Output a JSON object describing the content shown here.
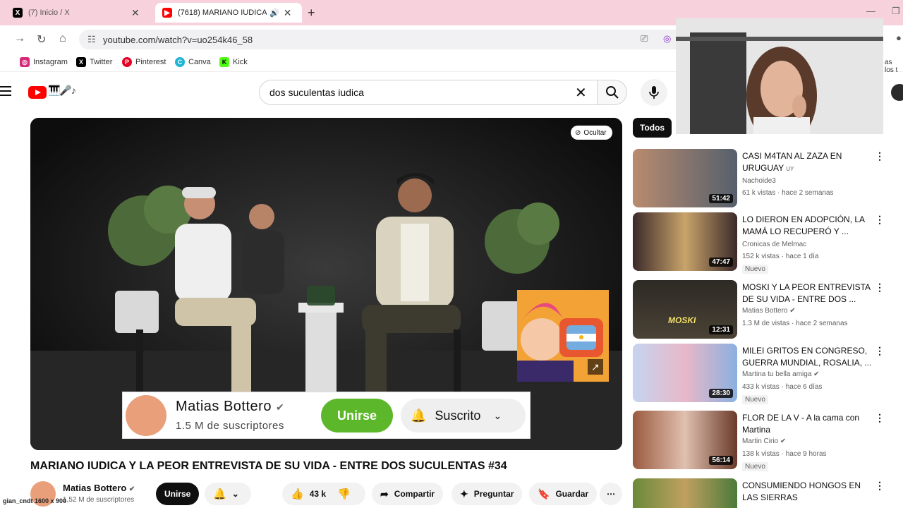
{
  "browser": {
    "tabs": [
      {
        "title": "(7) Inicio / X",
        "icon": "x-logo-icon"
      },
      {
        "title": "(7618) MARIANO IUDICA Y",
        "icon": "youtube-icon"
      }
    ],
    "url": "youtube.com/watch?v=uo254k46_58",
    "bookmarks": [
      "Instagram",
      "Twitter",
      "Pinterest",
      "Canva",
      "Kick"
    ],
    "right_overflow": "as los t"
  },
  "youtube": {
    "search_query": "dos suculentas iudica",
    "player": {
      "hide_label": "Ocultar",
      "card": {
        "channel": "Matias Bottero",
        "subscribers": "1.5 M de suscriptores",
        "join": "Unirse",
        "subscribed": "Suscrito"
      }
    },
    "video_title": "MARIANO IUDICA Y LA PEOR ENTREVISTA DE SU VIDA - ENTRE DOS SUCULENTAS #34",
    "channel": {
      "name": "Matias Bottero",
      "subscribers": "1,52 M de suscriptores"
    },
    "actions": {
      "join": "Unirse",
      "likes": "43 k",
      "share": "Compartir",
      "ask": "Preguntar",
      "save": "Guardar"
    },
    "watermark": "gian_cndt  1600 x 900",
    "chip": "Todos",
    "recommendations": [
      {
        "title": "CASI M4TAN AL ZAZA EN URUGUAY",
        "flag": "UY",
        "channel": "Nachoide3",
        "meta": "61 k vistas · hace 2 semanas",
        "duration": "51:42",
        "badge": ""
      },
      {
        "title": "LO DIERON EN ADOPCIÓN, LA MAMÁ LO RECUPERÓ Y ...",
        "flag": "",
        "channel": "Cronicas de Melmac",
        "meta": "152 k vistas · hace 1 día",
        "duration": "47:47",
        "badge": "Nuevo"
      },
      {
        "title": "MOSKI Y LA PEOR ENTREVISTA DE SU VIDA - ENTRE DOS ...",
        "flag": "",
        "channel": "Matias Bottero",
        "meta": "1.3 M de vistas · hace 2 semanas",
        "duration": "12:31",
        "badge": ""
      },
      {
        "title": "MILEI GRITOS EN CONGRESO, GUERRA MUNDIAL, ROSALIA, ...",
        "flag": "",
        "channel": "Martina tu bella amiga",
        "meta": "433 k vistas · hace 6 días",
        "duration": "28:30",
        "badge": "Nuevo"
      },
      {
        "title": "FLOR DE LA V - A la cama con Martina",
        "flag": "",
        "channel": "Martin Cirio",
        "meta": "138 k vistas · hace 9 horas",
        "duration": "56:14",
        "badge": "Nuevo"
      },
      {
        "title": "CONSUMIENDO HONGOS EN LAS SIERRAS",
        "flag": "",
        "channel": "",
        "meta": "",
        "duration": "",
        "badge": ""
      }
    ]
  }
}
